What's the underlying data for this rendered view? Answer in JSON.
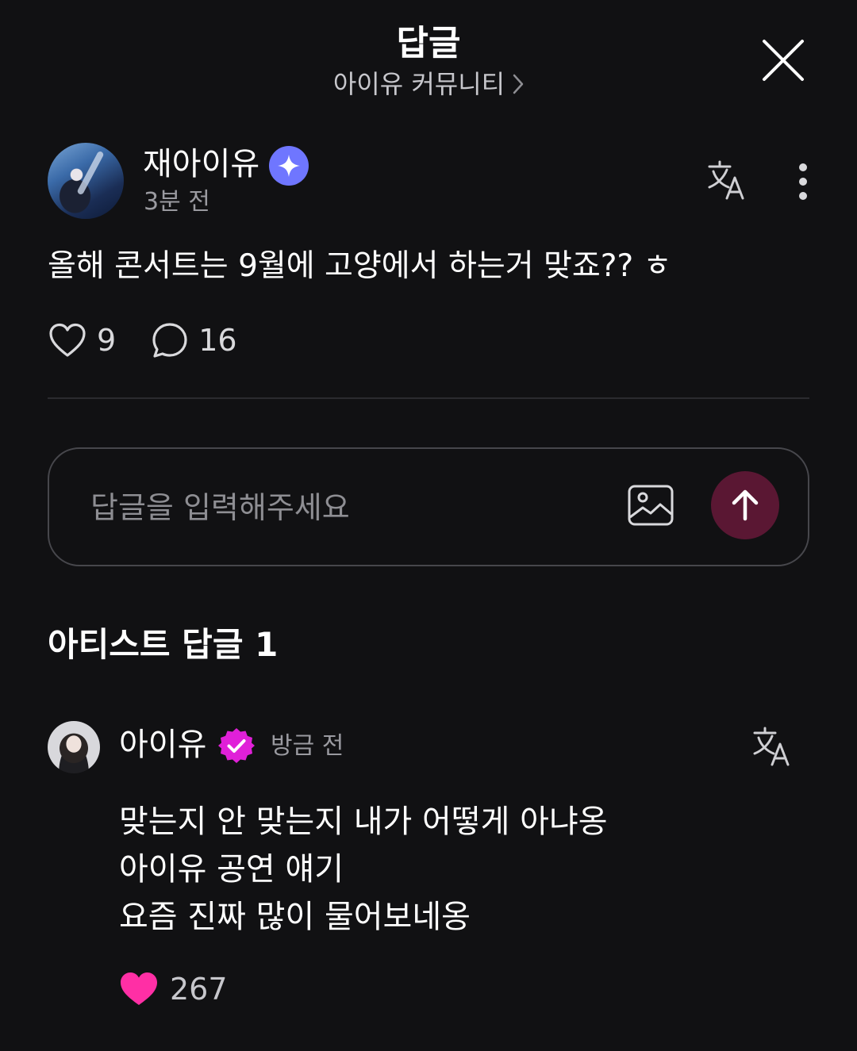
{
  "header": {
    "title": "답글",
    "community": "아이유 커뮤니티"
  },
  "post": {
    "author": "재아이유",
    "time": "3분 전",
    "body": "올해 콘서트는 9월에 고양에서 하는거 맞죠?? ㅎ",
    "likes": "9",
    "comments": "16"
  },
  "reply_input": {
    "placeholder": "답글을 입력해주세요"
  },
  "artist_replies": {
    "section_title": "아티스트 답글 1",
    "items": [
      {
        "author": "아이유",
        "time": "방금 전",
        "lines": [
          "맞는지 안 맞는지 내가 어떻게 아냐옹",
          "아이유 공연 얘기",
          "요즘 진짜 많이 물어보네옹"
        ],
        "likes": "267"
      }
    ]
  },
  "colors": {
    "background": "#111113",
    "star_badge": "#6f76ff",
    "artist_badge": "#e020d8",
    "liked_heart": "#ff2fa5",
    "send_button": "#5a1733"
  },
  "icons": [
    "close-icon",
    "chevron-right-icon",
    "star-badge-icon",
    "translate-icon",
    "more-vertical-icon",
    "heart-outline-icon",
    "comment-icon",
    "image-icon",
    "arrow-up-icon",
    "verified-badge-icon",
    "heart-filled-icon"
  ]
}
